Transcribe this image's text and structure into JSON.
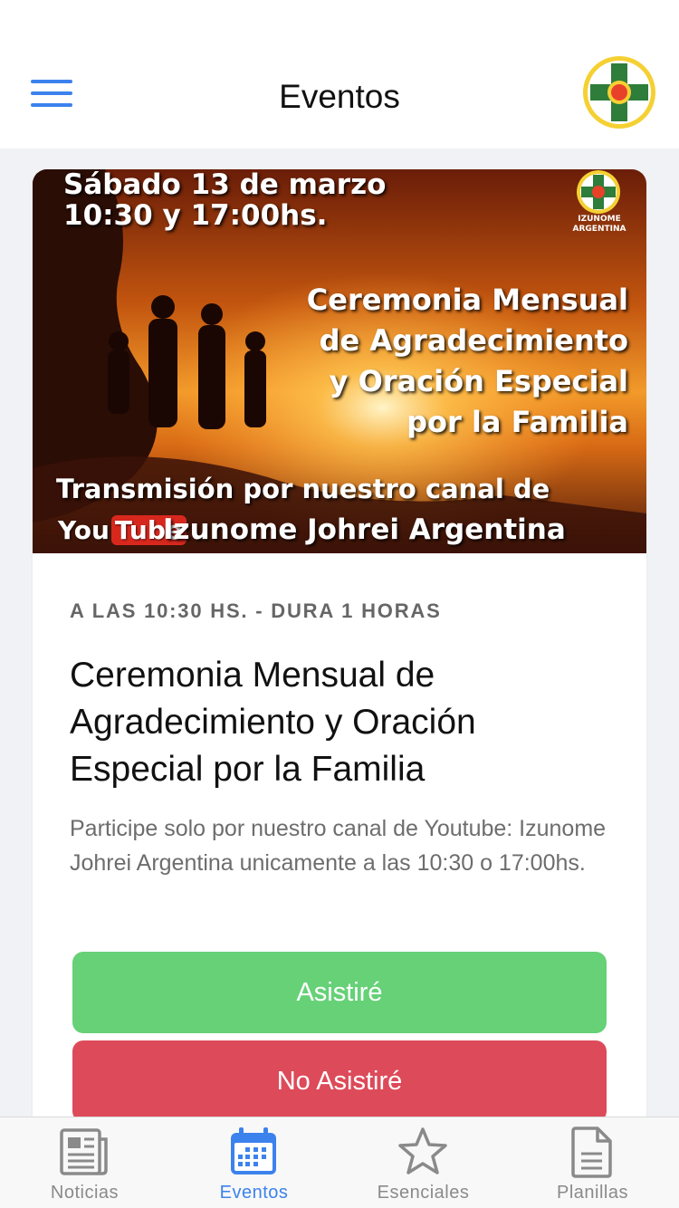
{
  "header": {
    "title": "Eventos"
  },
  "event": {
    "banner": {
      "date_line1": "Sábado 13 de marzo",
      "date_line2": "10:30 y 17:00hs.",
      "title_lines": [
        "Ceremonia Mensual",
        "de Agradecimiento",
        "y Oración Especial",
        "por la Familia"
      ],
      "transmission": "Transmisión por nuestro canal de",
      "youtube_you": "You",
      "youtube_tube": "Tube",
      "channel": "Izunome Johrei Argentina",
      "logo_text_1": "IZUNOME",
      "logo_text_2": "ARGENTINA"
    },
    "meta": "A LAS 10:30 HS. - DURA 1 HORAS",
    "title": "Ceremonia Mensual de Agradecimiento y Oración Especial por la Familia",
    "description": "Participe solo por nuestro canal de Youtube: Izunome Johrei Argentina unicamente a las 10:30 o 17:00hs.",
    "attend_label": "Asistiré",
    "not_attend_label": "No Asistiré"
  },
  "colors": {
    "accent": "#3c82ed",
    "attend": "#66d177",
    "not_attend": "#dd4a5a"
  },
  "tabs": [
    {
      "label": "Noticias",
      "icon": "newspaper-icon",
      "active": false
    },
    {
      "label": "Eventos",
      "icon": "calendar-icon",
      "active": true
    },
    {
      "label": "Esenciales",
      "icon": "star-icon",
      "active": false
    },
    {
      "label": "Planillas",
      "icon": "document-icon",
      "active": false
    }
  ]
}
